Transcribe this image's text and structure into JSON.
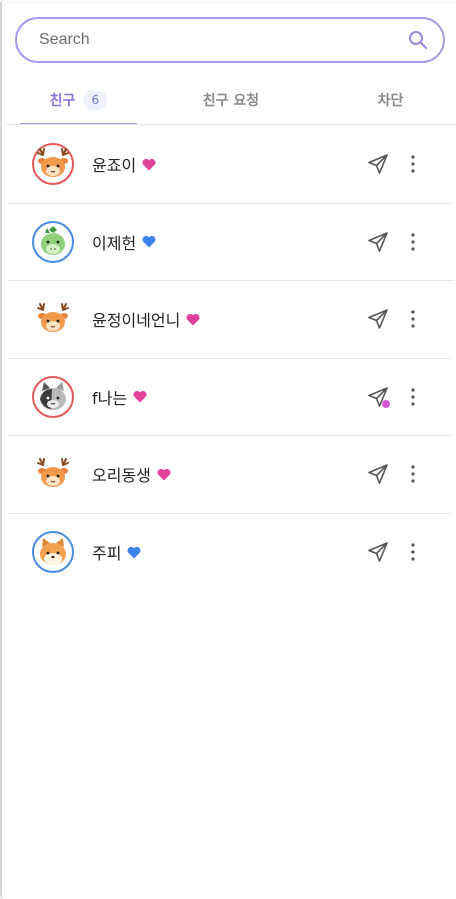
{
  "search": {
    "placeholder": "Search",
    "value": ""
  },
  "tabs": [
    {
      "label": "친구",
      "badge": "6",
      "active": true
    },
    {
      "label": "친구 요청",
      "active": false
    },
    {
      "label": "차단",
      "active": false
    }
  ],
  "friends": [
    {
      "name": "윤죠이",
      "heart_color": "#e0429a",
      "avatar": "deer",
      "ring": "red",
      "has_dot": false
    },
    {
      "name": "이제헌",
      "heart_color": "#3e82f0",
      "avatar": "dragon",
      "ring": "blue",
      "has_dot": false
    },
    {
      "name": "윤정이네언니",
      "heart_color": "#e0429a",
      "avatar": "deer",
      "ring": "none",
      "has_dot": false
    },
    {
      "name": "f나는",
      "heart_color": "#e0429a",
      "avatar": "cat",
      "ring": "red",
      "has_dot": true
    },
    {
      "name": "오리동생",
      "heart_color": "#e0429a",
      "avatar": "deer",
      "ring": "none",
      "has_dot": false
    },
    {
      "name": "주피",
      "heart_color": "#3e82f0",
      "avatar": "shiba",
      "ring": "blue",
      "has_dot": false
    }
  ],
  "colors": {
    "accent": "#a897e6",
    "accent_text": "#8b73d8",
    "ring_red": "#e45858",
    "ring_blue": "#4a8be8",
    "notify_dot": "#d65ad8"
  },
  "icons": {
    "search": "search-icon",
    "send": "paper-plane-icon",
    "more": "more-vertical-icon",
    "heart": "heart-icon"
  }
}
